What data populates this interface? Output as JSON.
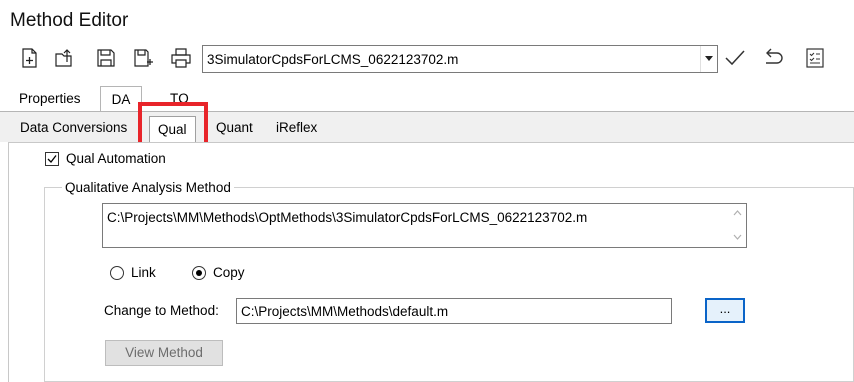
{
  "window": {
    "title": "Method Editor"
  },
  "toolbar": {
    "icons": [
      "new-method-icon",
      "open-method-icon",
      "save-icon",
      "save-as-icon",
      "print-icon"
    ],
    "method_file": "3SimulatorCpdsForLCMS_0622123702.m",
    "actions": [
      "apply-check-icon",
      "undo-icon",
      "checklist-icon"
    ]
  },
  "main_tabs": [
    "Properties",
    "DA",
    "TQ"
  ],
  "main_tabs_active": "DA",
  "sub_tabs": [
    "Data Conversions",
    "Qual",
    "Quant",
    "iReflex"
  ],
  "sub_tabs_active": "Qual",
  "highlight_color": "#e8242a",
  "qual": {
    "automation_label": "Qual Automation",
    "automation_checked": true,
    "group_title": "Qualitative Analysis Method",
    "method_path": "C:\\Projects\\MM\\Methods\\OptMethods\\3SimulatorCpdsForLCMS_0622123702.m",
    "radio_link": "Link",
    "radio_copy": "Copy",
    "selected_radio": "Copy",
    "change_label": "Change to Method:",
    "change_value": "C:\\Projects\\MM\\Methods\\default.m",
    "browse_label": "...",
    "view_button": "View Method"
  }
}
